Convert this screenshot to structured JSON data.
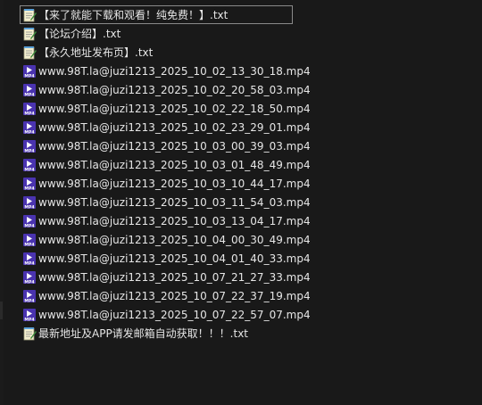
{
  "files": [
    {
      "name": "【来了就能下载和观看！纯免费！】.txt",
      "type": "txt",
      "focused": true
    },
    {
      "name": "【论坛介绍】.txt",
      "type": "txt"
    },
    {
      "name": "【永久地址发布页】.txt",
      "type": "txt"
    },
    {
      "name": "www.98T.la@juzi1213_2025_10_02_13_30_18.mp4",
      "type": "mp4"
    },
    {
      "name": "www.98T.la@juzi1213_2025_10_02_20_58_03.mp4",
      "type": "mp4"
    },
    {
      "name": "www.98T.la@juzi1213_2025_10_02_22_18_50.mp4",
      "type": "mp4"
    },
    {
      "name": "www.98T.la@juzi1213_2025_10_02_23_29_01.mp4",
      "type": "mp4"
    },
    {
      "name": "www.98T.la@juzi1213_2025_10_03_00_39_03.mp4",
      "type": "mp4"
    },
    {
      "name": "www.98T.la@juzi1213_2025_10_03_01_48_49.mp4",
      "type": "mp4"
    },
    {
      "name": "www.98T.la@juzi1213_2025_10_03_10_44_17.mp4",
      "type": "mp4"
    },
    {
      "name": "www.98T.la@juzi1213_2025_10_03_11_54_03.mp4",
      "type": "mp4"
    },
    {
      "name": "www.98T.la@juzi1213_2025_10_03_13_04_17.mp4",
      "type": "mp4"
    },
    {
      "name": "www.98T.la@juzi1213_2025_10_04_00_30_49.mp4",
      "type": "mp4"
    },
    {
      "name": "www.98T.la@juzi1213_2025_10_04_01_40_33.mp4",
      "type": "mp4"
    },
    {
      "name": "www.98T.la@juzi1213_2025_10_07_21_27_33.mp4",
      "type": "mp4"
    },
    {
      "name": "www.98T.la@juzi1213_2025_10_07_22_37_19.mp4",
      "type": "mp4"
    },
    {
      "name": "www.98T.la@juzi1213_2025_10_07_22_57_07.mp4",
      "type": "mp4"
    },
    {
      "name": "最新地址及APP请发邮箱自动获取！！！.txt",
      "type": "txt"
    }
  ],
  "icons": {
    "txt": {
      "name": "notepad-text-file-icon",
      "color": "#f5f0c8"
    },
    "mp4": {
      "name": "mp4-video-file-icon",
      "color": "#5b3fc4",
      "label": "MP4"
    }
  },
  "colors": {
    "background": "#191919",
    "text": "#e6e6e6",
    "focus_border": "#8a8a8a"
  }
}
